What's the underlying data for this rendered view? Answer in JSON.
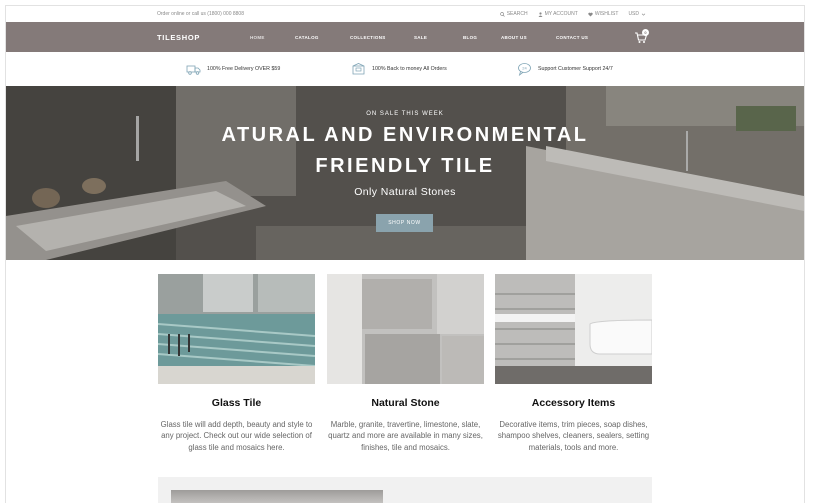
{
  "topbar": {
    "contact": "Order online or call us (1800) 000 8808",
    "search": "SEARCH",
    "account": "MY ACCOUNT",
    "wishlist": "WISHLIST",
    "currency": "USD"
  },
  "nav": {
    "logo": "TILESHOP",
    "items": [
      "HOME",
      "CATALOG",
      "COLLECTIONS",
      "SALE",
      "BLOG",
      "ABOUT US",
      "CONTACT US"
    ],
    "cart_count": "0"
  },
  "features": [
    {
      "icon": "truck-icon",
      "label": "100% Free Delivery OVER $59"
    },
    {
      "icon": "box-icon",
      "label": "100% Back to money All Orders"
    },
    {
      "icon": "chat-icon",
      "label": "Support Customer Support 24/7"
    }
  ],
  "hero": {
    "eyebrow": "ON SALE THIS WEEK",
    "headline_line1": "ATURAL AND ENVIRONMENTAL",
    "headline_line2": "FRIENDLY TILE",
    "subline": "Only Natural Stones",
    "button": "SHOP NOW"
  },
  "products": [
    {
      "title": "Glass Tile",
      "desc": "Glass tile will add depth, beauty and style to any project. Check out our wide selection of glass tile and mosaics here."
    },
    {
      "title": "Natural Stone",
      "desc": "Marble, granite, travertine, limestone, slate, quartz and more are available in many sizes, finishes, tile and mosaics."
    },
    {
      "title": "Accessory Items",
      "desc": "Decorative items, trim pieces, soap dishes, shampoo shelves, cleaners, sealers, setting materials, tools and more."
    }
  ],
  "colors": {
    "nav_bg": "#847a79",
    "button_bg": "#8aa3ad"
  }
}
